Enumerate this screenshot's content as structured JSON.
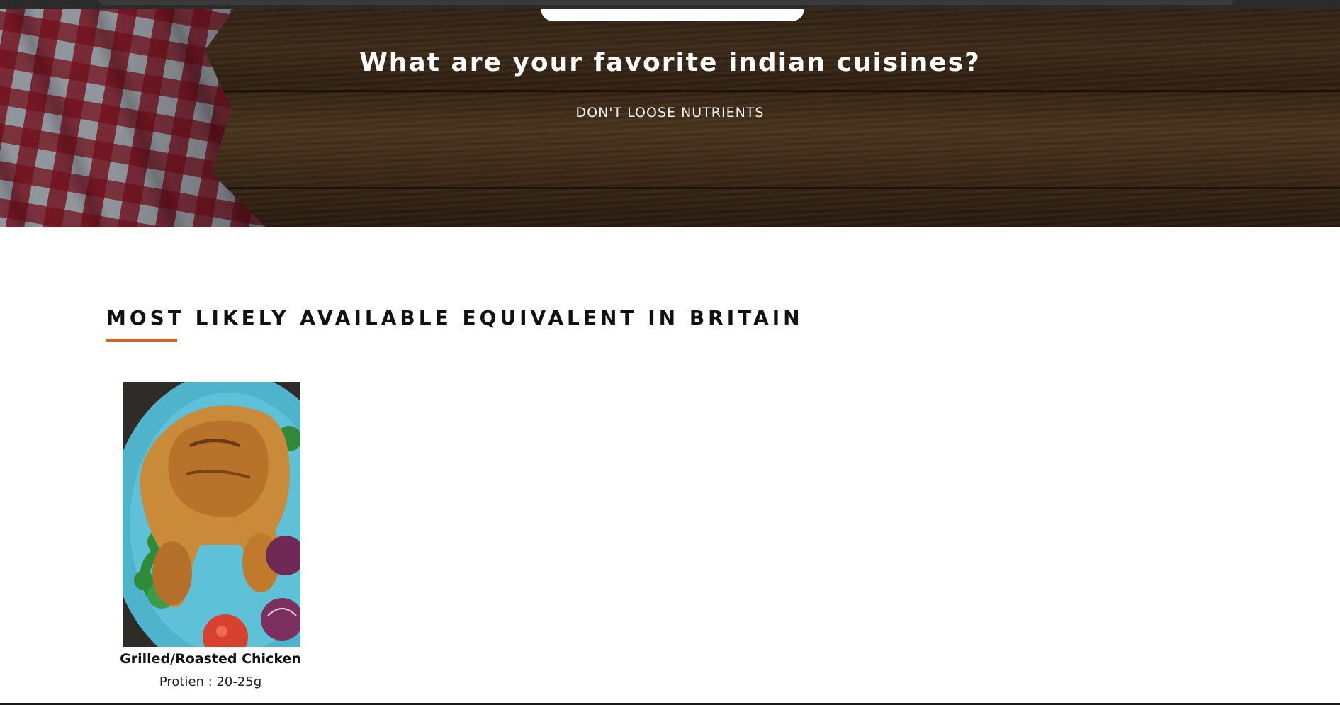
{
  "hero": {
    "title": "What are your favorite indian cuisines?",
    "subtitle": "DON'T LOOSE NUTRIENTS"
  },
  "section": {
    "title": "MOST LIKELY AVAILABLE EQUIVALENT IN BRITAIN",
    "accent_color": "#d2642a"
  },
  "items": [
    {
      "name": "Grilled/Roasted Chicken",
      "protein": "Protien : 20-25g",
      "image_icon": "roasted-chicken-photo"
    }
  ]
}
